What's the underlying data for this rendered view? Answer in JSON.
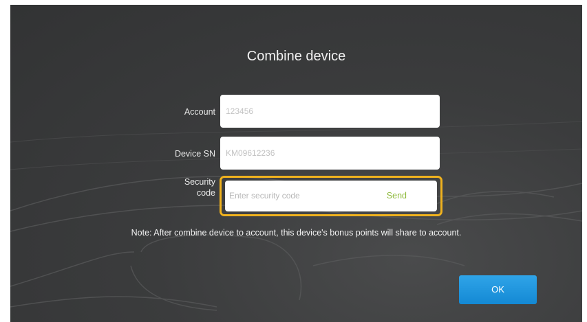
{
  "dialog": {
    "title": "Combine device"
  },
  "form": {
    "account": {
      "label": "Account",
      "value": "123456"
    },
    "device_sn": {
      "label": "Device SN",
      "value": "KM09612236"
    },
    "security_code": {
      "label_line1": "Security",
      "label_line2": "code",
      "placeholder": "Enter security code",
      "send_label": "Send"
    }
  },
  "note": "Note: After combine device to account, this device's bonus points will share to account.",
  "ok_label": "OK",
  "colors": {
    "background": "#38393a",
    "highlight_border": "#f0b21e",
    "send_text": "#8fba3c",
    "ok_button": "#1f96de"
  }
}
